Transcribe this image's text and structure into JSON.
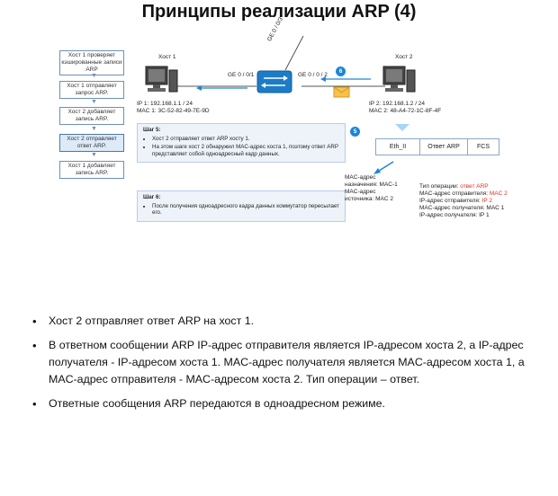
{
  "title": "Принципы реализации ARP (4)",
  "flow": [
    "Хост 1 проверяет кэшированные записи ARP",
    "Хост 1 отправляет запрос ARP.",
    "Хост 2 добавляет запись ARP.",
    "Хост 2 отправляет ответ ARP.",
    "Хост 1 добавляет запись ARP."
  ],
  "hosts": {
    "host1_label": "Хост 1",
    "host2_label": "Хост 2",
    "host1_ip": "IP 1: 192.168.1.1 / 24",
    "host1_mac": "MAC 1: 3C-52-82-49-7E-9D",
    "host2_ip": "IP 2: 192.168.1.2 / 24",
    "host2_mac": "MAC 2: 48-A4-72-1C-8F-4F"
  },
  "switch": {
    "port_left": "GE 0 / 0/1",
    "port_right": "GE 0 / 0 / 2",
    "port_top": "GE 0 / 0/3"
  },
  "badges": {
    "b6_top": "6",
    "b5": "5"
  },
  "step5": {
    "title": "Шаг 5:",
    "items": [
      "Хост 2 отправляет ответ ARP хосту 1.",
      "На этом шаге хост 2 обнаружил MAC-адрес хоста 1, поэтому ответ ARP представляет собой одноадресный кадр данных."
    ]
  },
  "step6": {
    "title": "Шаг 6:",
    "items": [
      "После получения одноадресного кадра данных коммутатор пересылает его."
    ]
  },
  "frame": {
    "eth": "Eth_II",
    "arp": "Ответ ARP",
    "fcs": "FCS"
  },
  "eth_detail": {
    "line1": "MAC-адрес",
    "line2": "назначения: MAC-1",
    "line3": "MAC-адрес",
    "line4": "источника: MAC 2"
  },
  "arp_detail": {
    "op_label": "Тип операции: ",
    "op_value": "ответ ARP",
    "smac_label": "MAC-адрес отправителя: ",
    "smac_value": "MAC 2",
    "sip_label": "IP-адрес отправителя: ",
    "sip_value": "IP 2",
    "dmac": "MAC-адрес получателя: MAC 1",
    "dip": "IP-адрес получателя: IP 1"
  },
  "bullets": [
    "Хост 2 отправляет ответ ARP на хост 1.",
    "В ответном сообщении ARP IP-адрес отправителя является IP-адресом хоста 2, а IP-адрес получателя - IP-адресом хоста 1. MAC-адрес получателя является MAC-адресом хоста 1, а MAC-адрес отправителя - MAC-адресом хоста 2. Тип операции – ответ.",
    "Ответные сообщения ARP передаются в одноадресном режиме."
  ]
}
